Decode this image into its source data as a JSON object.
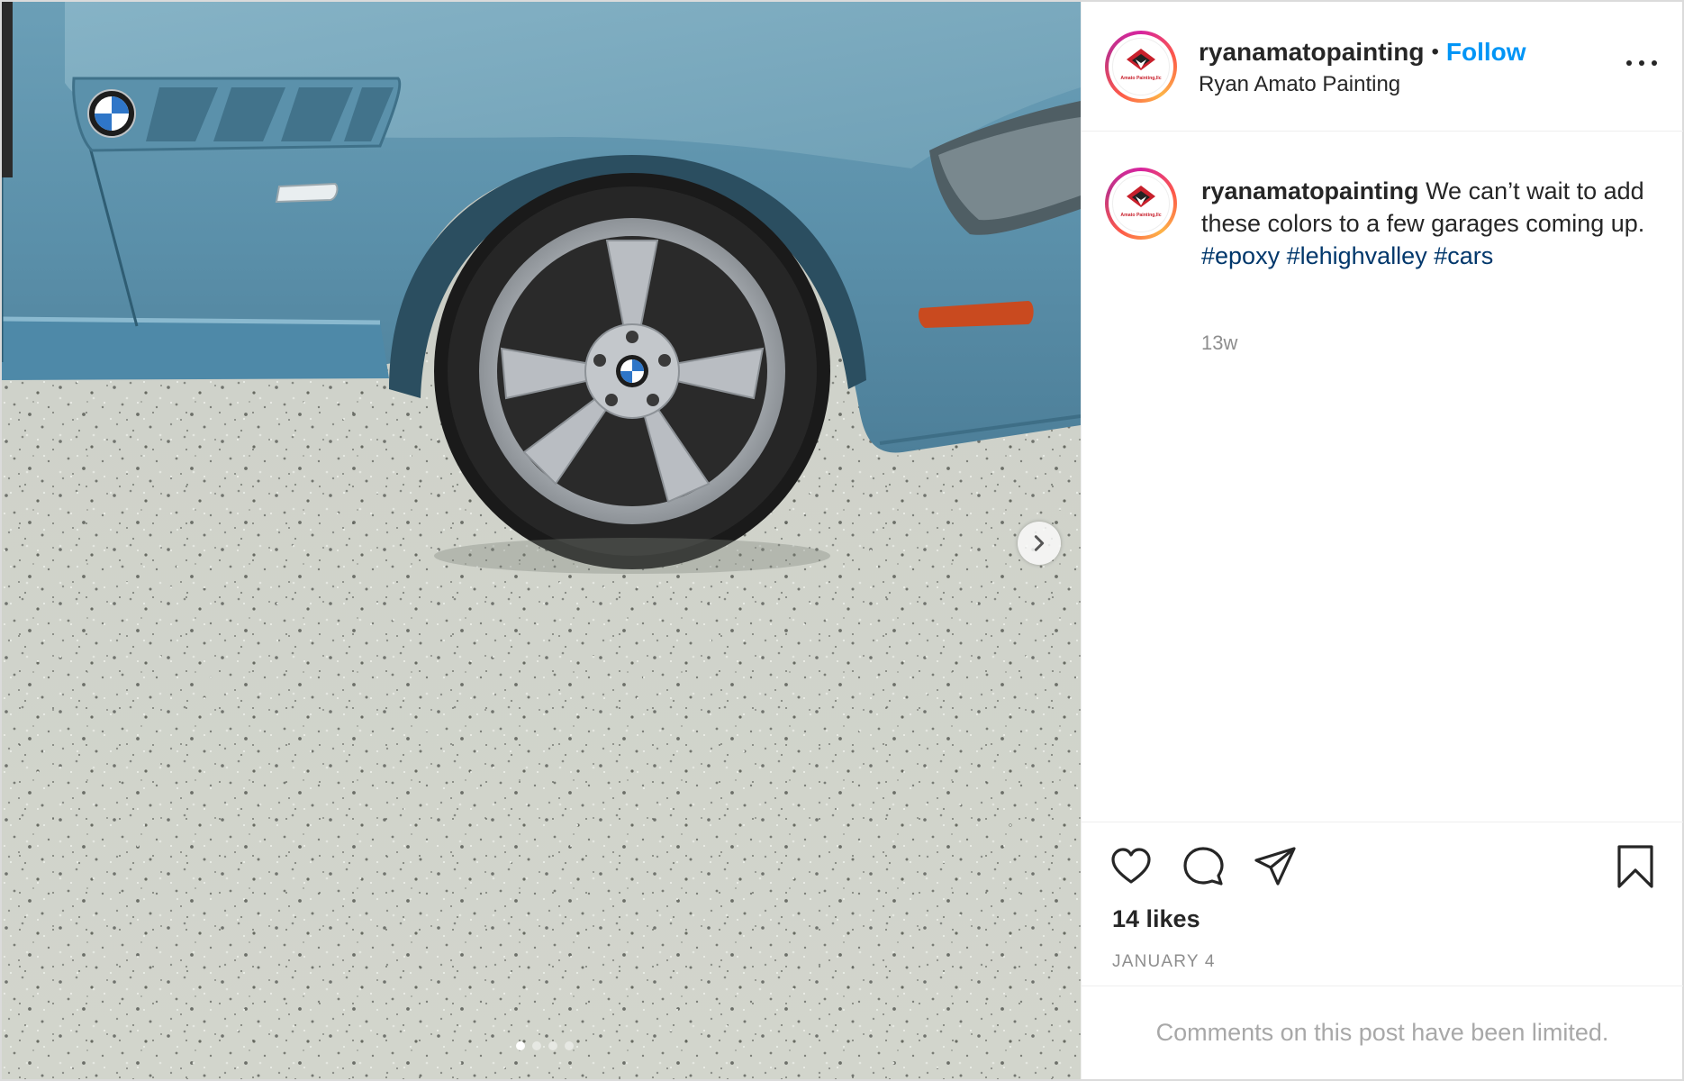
{
  "media": {
    "carousel_count": 4,
    "active_index": 0,
    "next_button": "chevron-right-icon"
  },
  "header": {
    "username": "ryanamatopainting",
    "separator": "•",
    "follow_label": "Follow",
    "subtitle": "Ryan Amato Painting",
    "more_icon": "more-horizontal-icon",
    "avatar_text": "Amato Painting,llc"
  },
  "caption": {
    "username": "ryanamatopainting",
    "text": "We can’t wait to add these colors to a few garages coming up.",
    "hashtags": [
      "#epoxy",
      "#lehighvalley",
      "#cars"
    ],
    "time_ago": "13w"
  },
  "actions": {
    "icons": [
      "heart-icon",
      "comment-icon",
      "share-icon",
      "bookmark-icon"
    ],
    "likes": "14 likes",
    "date": "JANUARY 4"
  },
  "comments": {
    "limited_text": "Comments on this post have been limited."
  },
  "colors": {
    "accent": "#0095f6",
    "hashtag": "#00376b",
    "muted": "#8e8e8e",
    "car_body": "#5d93ad",
    "floor": "#c9ccc4"
  }
}
